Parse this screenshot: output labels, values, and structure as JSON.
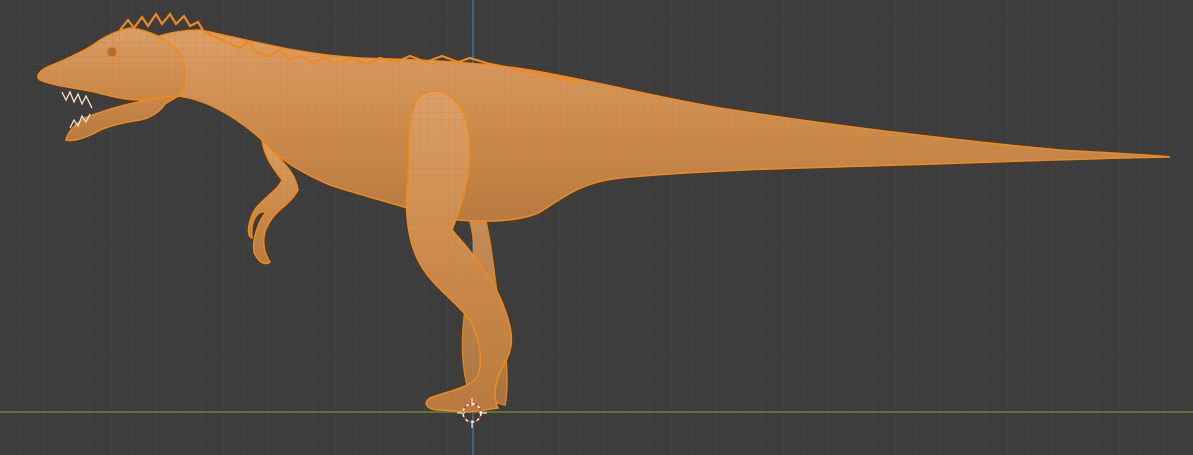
{
  "viewport": {
    "background": "#3d3d3d",
    "grid_minor_color": "#474747",
    "grid_major_color": "#4f4f4f",
    "x_axis_color": "#6c9a2c",
    "z_axis_color": "#3f78c2",
    "selection_outline_color": "#f08a1c",
    "mesh_fill_color": "#c98a4c",
    "wire_color": "#e07d20"
  },
  "scene": {
    "object": "dinosaur-mesh",
    "selected": true,
    "view": "orthographic-side",
    "display": "solid-with-wireframe-overlay"
  },
  "cursor": {
    "icon": "3d-cursor-icon"
  }
}
